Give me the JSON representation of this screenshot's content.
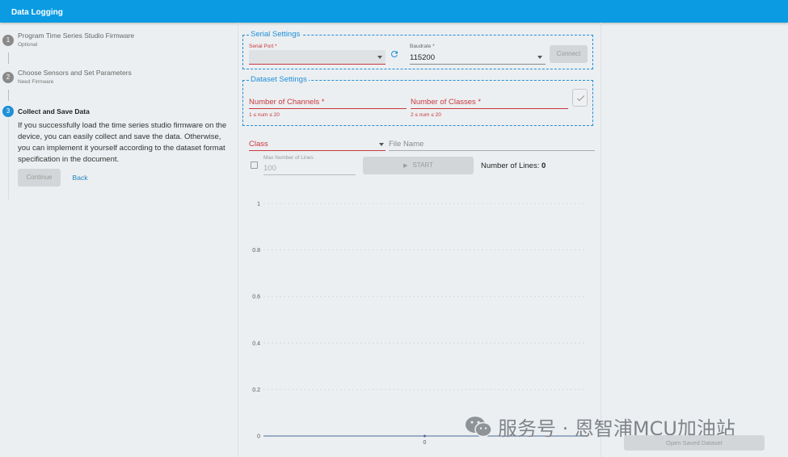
{
  "appbar": {
    "title": "Data Logging"
  },
  "stepper": {
    "steps": [
      {
        "num": "1",
        "title": "Program Time Series Studio Firmware",
        "sub": "Optional"
      },
      {
        "num": "2",
        "title": "Choose Sensors and Set Parameters",
        "sub": "Need Firmware"
      },
      {
        "num": "3",
        "title": "Collect and Save Data",
        "sub": ""
      }
    ],
    "description": "If you successfully load the time series studio firmware on the device, you can easily collect and save the data. Otherwise, you can implement it yourself according to the dataset format specification in the document.",
    "continue_label": "Continue",
    "back_label": "Back"
  },
  "serial": {
    "legend": "Serial Settings",
    "port_label": "Serial Port *",
    "port_value": "",
    "baud_label": "Baudrate *",
    "baud_value": "115200",
    "connect_label": "Connect"
  },
  "dataset": {
    "legend": "Dataset Settings",
    "channels_label": "Number of Channels *",
    "channels_helper": "1 ≤ num ≤ 20",
    "classes_label": "Number of Classes *",
    "classes_helper": "2 ≤ num ≤ 20"
  },
  "logging": {
    "class_label": "Class",
    "filename_placeholder": "File Name",
    "max_lines_label": "Max Number of Lines",
    "max_lines_value": "100",
    "start_label": "START",
    "lines_label": "Number of Lines:",
    "lines_count": "0"
  },
  "chart_data": {
    "type": "line",
    "y_ticks": [
      "1",
      "0.8",
      "0.6",
      "0.4",
      "0.2",
      "0"
    ],
    "x_ticks": [
      "0"
    ],
    "ylim": [
      0,
      1
    ],
    "series": [],
    "grid": true
  },
  "watermark": {
    "text": "服务号 · 恩智浦MCU加油站"
  },
  "open_saved_label": "Open Saved Dataset",
  "colors": {
    "primary": "#0a9be3",
    "error": "#c8383e",
    "accent": "#1e8fd8"
  }
}
